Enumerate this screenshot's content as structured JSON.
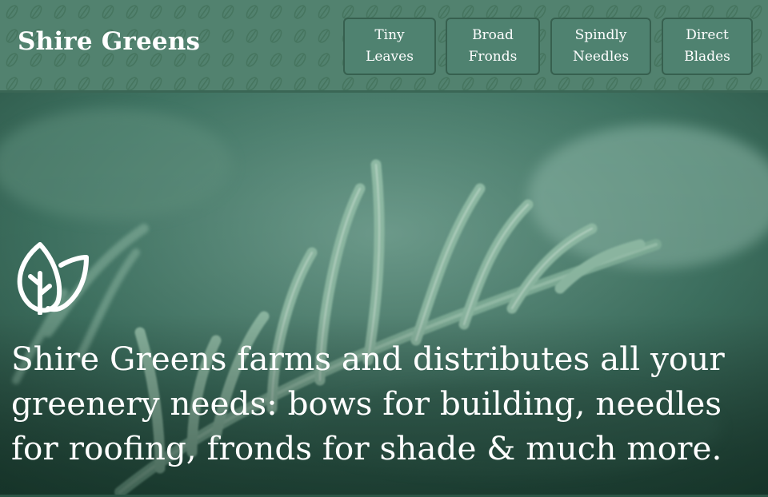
{
  "header": {
    "brand": "Shire Greens",
    "nav": [
      {
        "line1": "Tiny",
        "line2": "Leaves"
      },
      {
        "line1": "Broad",
        "line2": "Fronds"
      },
      {
        "line1": "Spindly",
        "line2": "Needles"
      },
      {
        "line1": "Direct",
        "line2": "Blades"
      }
    ]
  },
  "hero": {
    "logo_icon": "leaf-icon",
    "tagline": "Shire Greens farms and distributes all your greenery needs: bows for building, needles for roofing, fronds for shade & much more."
  },
  "colors": {
    "header_bg": "#52826f",
    "button_bg": "#4f8270",
    "button_border": "#37604f",
    "hero_tint": "#2e5a4c",
    "text": "#ffffff"
  }
}
